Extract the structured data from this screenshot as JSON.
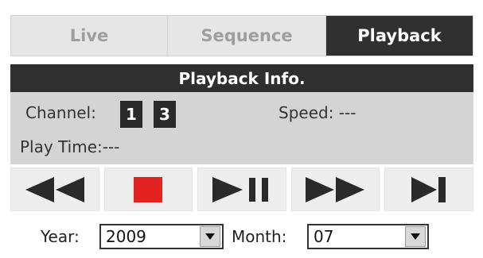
{
  "tabs": [
    {
      "label": "Live"
    },
    {
      "label": "Sequence"
    },
    {
      "label": "Playback"
    }
  ],
  "info": {
    "header": "Playback Info.",
    "channel_label": "Channel:",
    "channels": [
      "1",
      "3"
    ],
    "speed_label": "Speed:",
    "speed_value": "---",
    "playtime_label": "Play Time:",
    "playtime_value": "---"
  },
  "controls": [
    {
      "icon": "rewind-icon"
    },
    {
      "icon": "stop-icon"
    },
    {
      "icon": "play-pause-icon"
    },
    {
      "icon": "fast-forward-icon"
    },
    {
      "icon": "skip-end-icon"
    }
  ],
  "dates": {
    "year_label": "Year:",
    "year_value": "2009",
    "month_label": "Month:",
    "month_value": "07"
  },
  "colors": {
    "active_tab": "#303030",
    "stop": "#e32222",
    "panel": "#d4d4d4"
  }
}
